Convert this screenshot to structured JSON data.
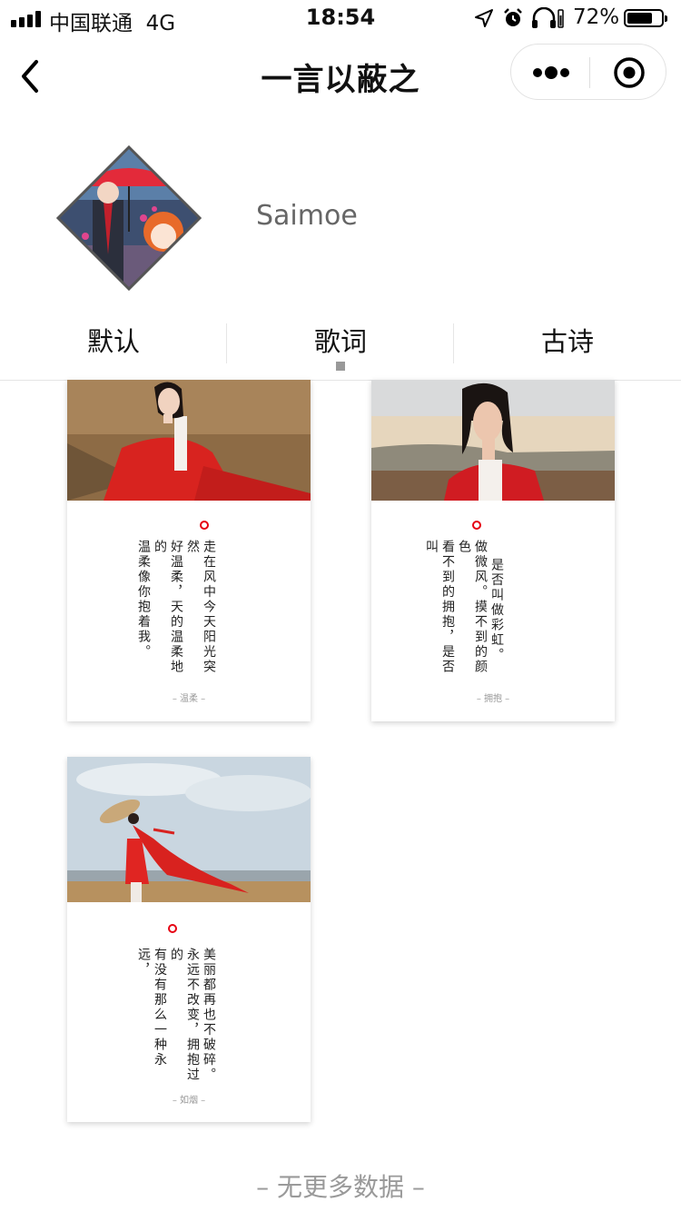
{
  "status_bar": {
    "carrier": "中国联通",
    "network": "4G",
    "time": "18:54",
    "battery_text": "72%",
    "battery_level": 0.72,
    "icons": [
      "signal-icon",
      "location-icon",
      "alarm-icon",
      "headphones-icon",
      "battery-icon"
    ]
  },
  "nav": {
    "title": "一言以蔽之",
    "back_icon": "chevron-left-icon",
    "menu_icon": "more-dots-icon",
    "close_icon": "target-circle-icon"
  },
  "profile": {
    "username": "Saimoe"
  },
  "tabs": [
    {
      "label": "默认",
      "active": false
    },
    {
      "label": "歌词",
      "active": true
    },
    {
      "label": "古诗",
      "active": false
    }
  ],
  "cards": [
    {
      "lines": [
        "走在风中今天阳光突然",
        "好温柔，天的温柔地的",
        "温柔像你抱着我。"
      ],
      "credit": "– 温柔 –"
    },
    {
      "lines": [
        "是否叫做彩虹。",
        "做微风。摸不到的颜色",
        "看不到的拥抱，是否叫"
      ],
      "credit": "– 拥抱 –"
    },
    {
      "lines": [
        "美丽都再也不破碎。",
        "永远不改变，拥抱过的",
        "有没有那么一种永远，"
      ],
      "credit": "– 如烟 –"
    }
  ],
  "footer": "– 无更多数据 –",
  "colors": {
    "accent_red": "#e60012",
    "muted_text": "#999999"
  }
}
